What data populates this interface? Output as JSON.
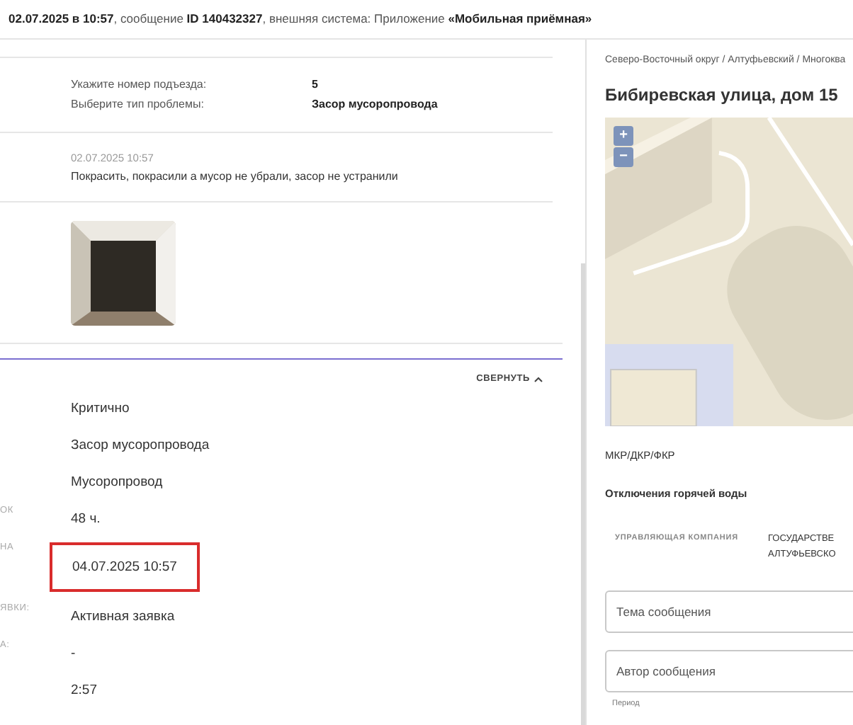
{
  "header": {
    "text": "**02.07.2025 в 10:57**, сообщение **ID 140432327**, внешняя система: Приложение **«Мобильная приёмная»**"
  },
  "answers": [
    {
      "question": "Укажите номер подъезда:",
      "answer": "5"
    },
    {
      "question": "Выберите тип проблемы:",
      "answer": "Засор мусоропровода"
    }
  ],
  "comment": {
    "date": "02.07.2025 10:57",
    "text": "Покрасить, покрасили а мусор не убрали, засор не устранили"
  },
  "collapse_button": {
    "label": "СВЕРНУТЬ",
    "expanded": true
  },
  "details": [
    {
      "value": "Критично",
      "highlighted": false
    },
    {
      "value": "Засор мусоропровода",
      "highlighted": false
    },
    {
      "value": "Мусоропровод",
      "highlighted": false
    },
    {
      "label": "ОК",
      "value": "48 ч.",
      "highlighted": false
    },
    {
      "label": "НА",
      "value": "04.07.2025 10:57",
      "highlighted": true
    },
    {
      "label": "ЯВКИ:",
      "value": "Активная заявка",
      "highlighted": false
    },
    {
      "label": "А:",
      "value": "-",
      "highlighted": false
    },
    {
      "value": "2:57",
      "highlighted": false
    }
  ],
  "right": {
    "breadcrumb": "Северо-Восточный округ / Алтуфьевский / Многоква",
    "title": "Бибиревская улица, дом 15",
    "map": {
      "zoom_in": "+",
      "zoom_out": "−"
    },
    "links": [
      "МКР/ДКР/ФКР",
      "Отключения горячей воды"
    ],
    "company": {
      "label": "УПРАВЛЯЮЩАЯ КОМПАНИЯ",
      "value_lines": [
        "ГОСУДАРСТВЕ",
        "АЛТУФЬЕВСКО"
      ]
    },
    "fields": [
      {
        "placeholder": "Тема сообщения"
      },
      {
        "placeholder": "Автор сообщения"
      }
    ],
    "period_legend": "Период"
  }
}
